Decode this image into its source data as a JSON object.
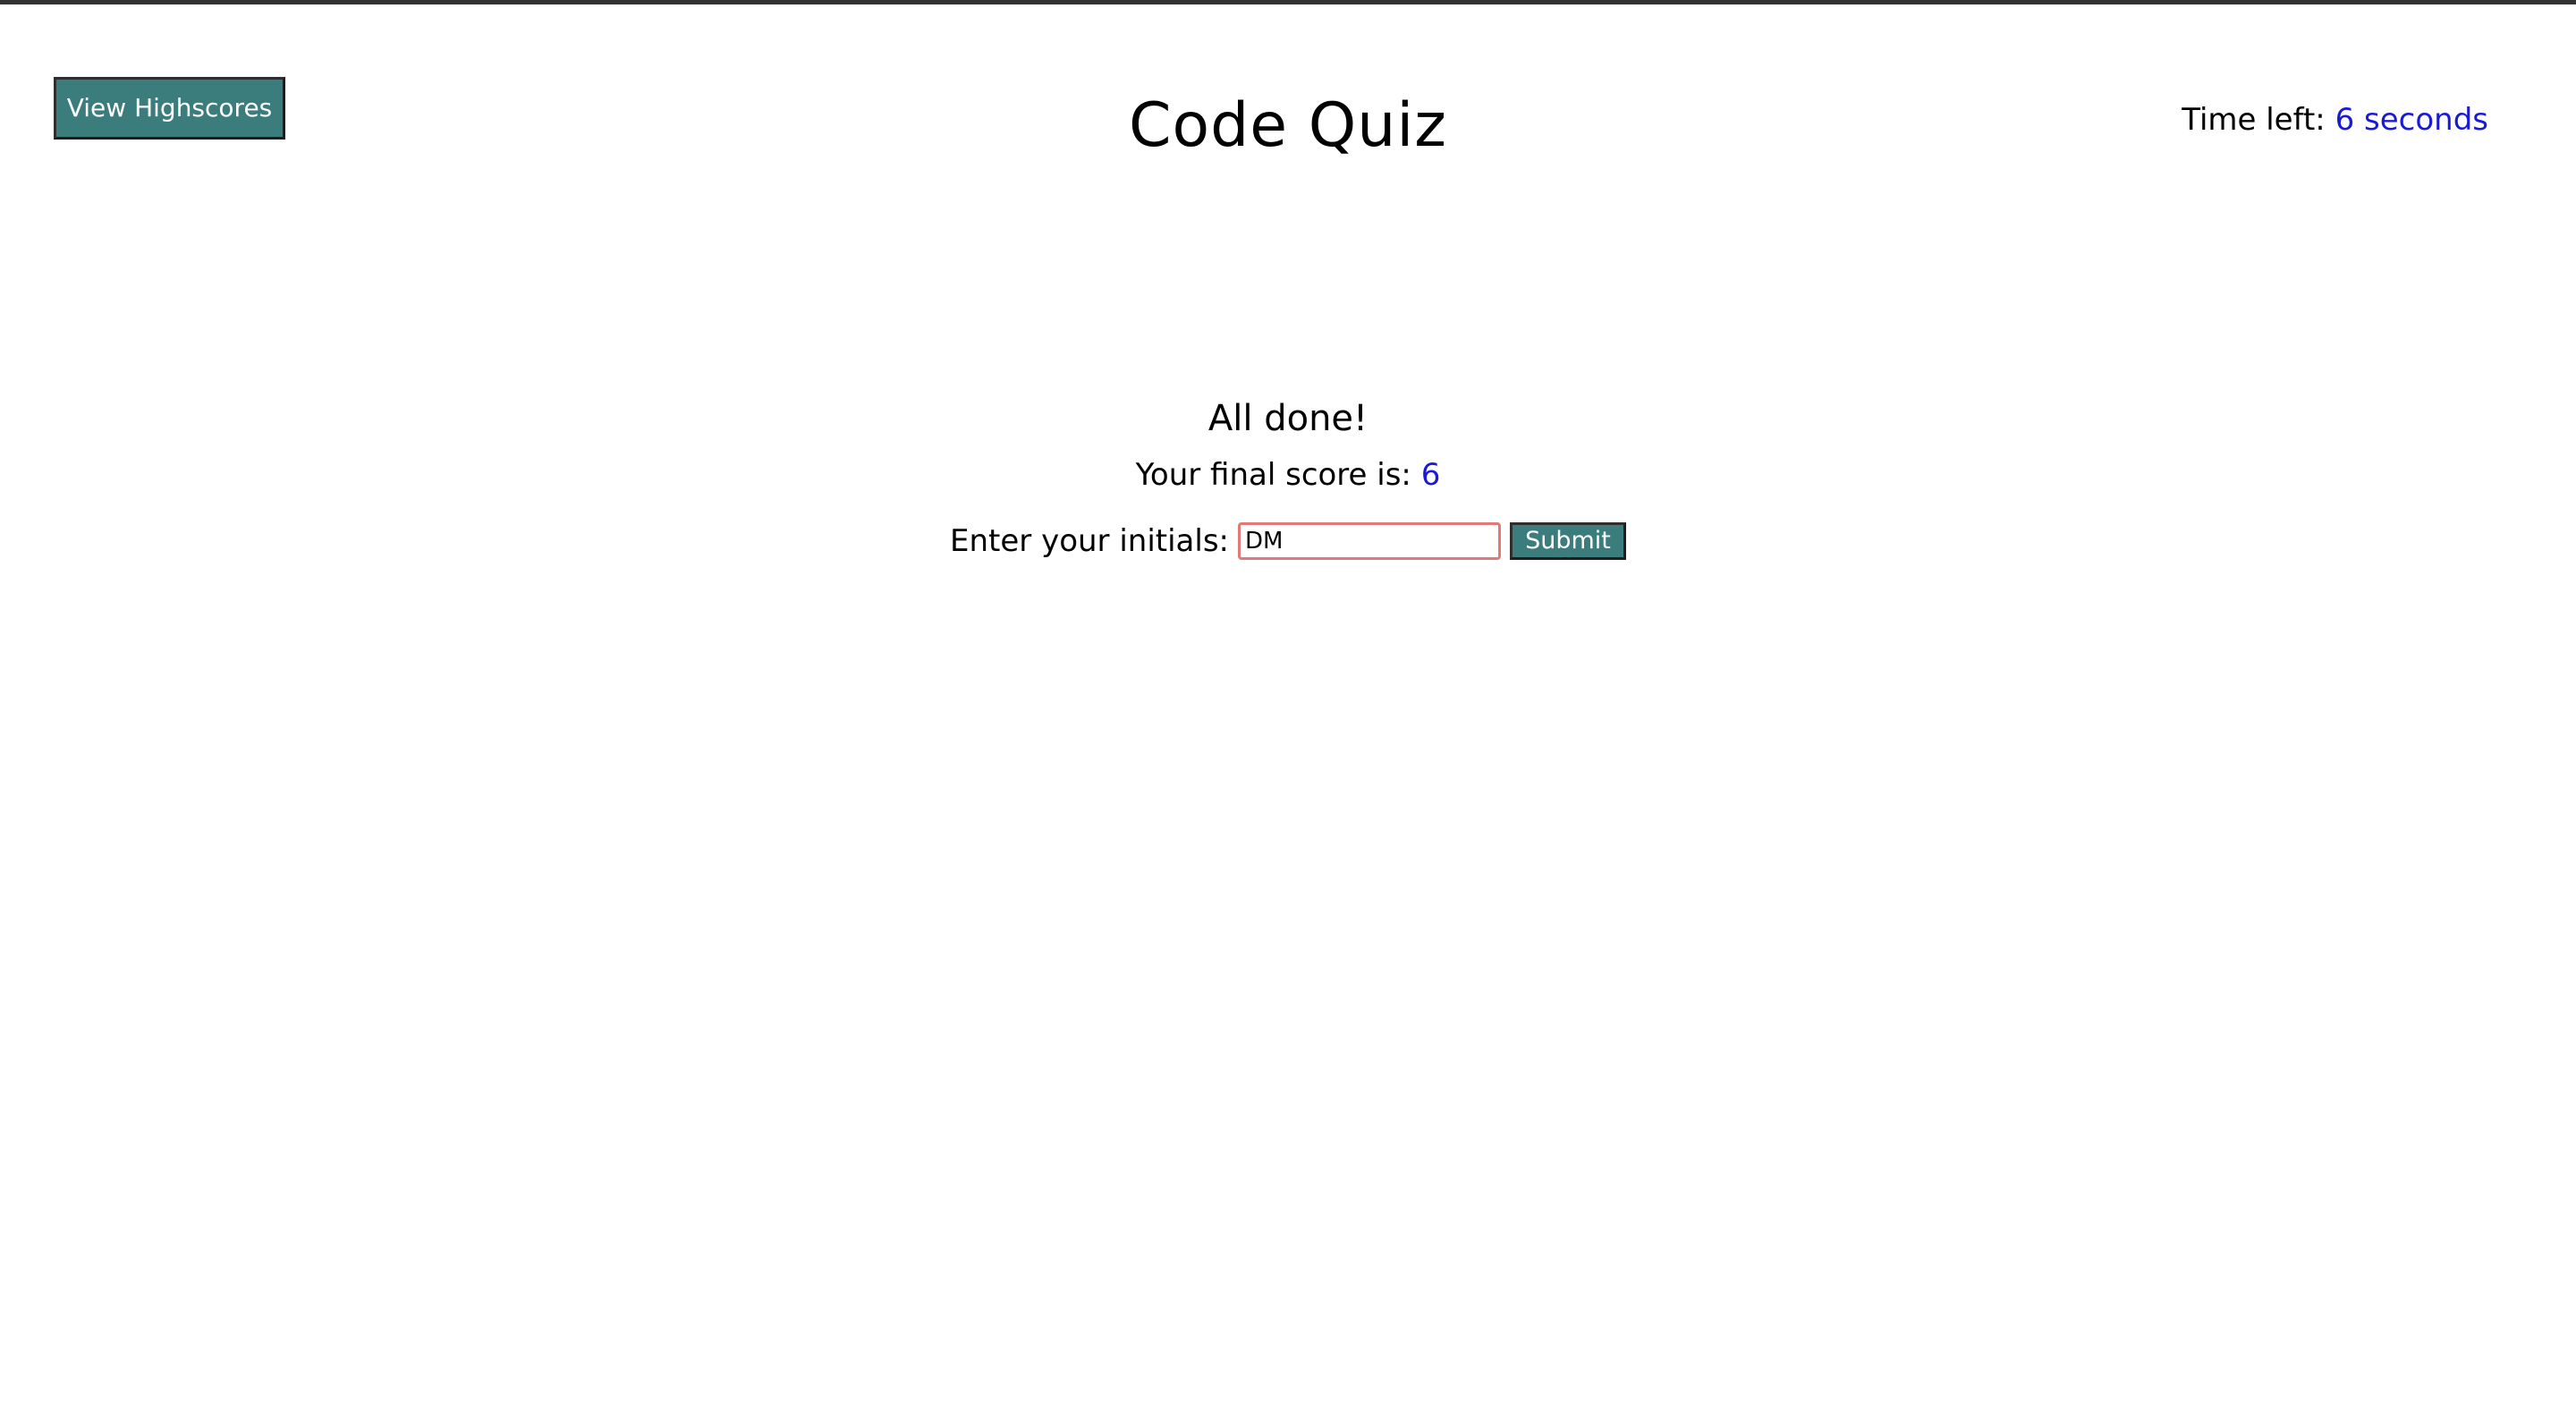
{
  "header": {
    "highscores_label": "View Highscores",
    "title": "Code Quiz",
    "timer_label": "Time left:",
    "timer_value": "6 seconds"
  },
  "result": {
    "heading": "All done!",
    "score_label": "Your final score is:",
    "score_value": "6",
    "initials_label": "Enter your initials:",
    "initials_value": "DM",
    "submit_label": "Submit"
  },
  "colors": {
    "button_bg": "#3a7d7c",
    "accent_text": "#1a1ad6",
    "input_border": "#e07a7a",
    "top_rule": "#333333"
  }
}
